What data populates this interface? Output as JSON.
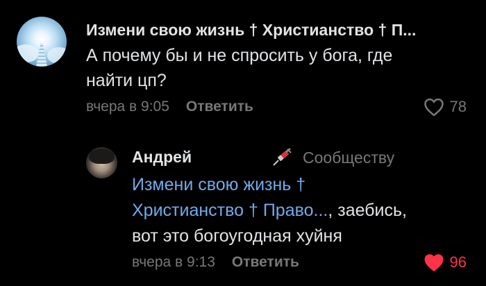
{
  "comments": [
    {
      "author": "Измени свою жизнь † Христианство † П...",
      "text_lines": [
        "А почему бы и не спросить у бога, где",
        "найти цп?"
      ],
      "time": "вчера в 9:05",
      "reply_label": "Ответить",
      "likes": "78",
      "liked": false,
      "avatar_icon": "heaven-stairs-icon"
    },
    {
      "author": "Андрей",
      "community_label": "Сообществу",
      "community_icon": "syringe-icon",
      "mention_lines": [
        "Измени свою жизнь †",
        "Христианство † Право..."
      ],
      "text_after_mention": ", заебись,",
      "text_last_line": "вот это богоугодная хуйня",
      "time": "вчера в 9:13",
      "reply_label": "Ответить",
      "likes": "96",
      "liked": true
    }
  ],
  "colors": {
    "background": "#000000",
    "text": "#e1e3e6",
    "secondary": "#76787a",
    "link": "#71aaeb",
    "like_active": "#ff3347"
  }
}
